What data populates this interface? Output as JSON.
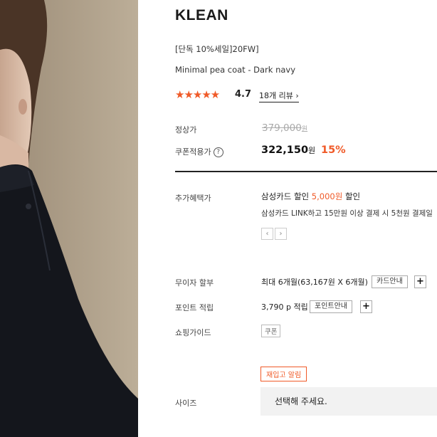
{
  "brand": "KLEAN",
  "promo": "[단독 10%세일]20FW]",
  "product_name": "Minimal pea coat - Dark navy",
  "rating": {
    "stars": "★★★★★",
    "score": "4.7",
    "reviews_link": "18개 리뷰 ›"
  },
  "price": {
    "regular_label": "정상가",
    "regular_value": "379,000",
    "regular_unit": "원",
    "coupon_label": "쿠폰적용가",
    "help_icon": "?",
    "sale_value": "322,150",
    "sale_unit": "원",
    "discount": "15%"
  },
  "benefits": {
    "label": "추가혜택가",
    "card_prefix": "삼성카드 할인 ",
    "card_amount": "5,000원",
    "card_suffix": " 할인",
    "description": "삼성카드 LINK하고 15만원 이상 결제 시 5천원 결제일",
    "prev": "‹",
    "next": "›"
  },
  "installment": {
    "label": "무이자 할부",
    "value": "최대 6개월(63,167원 X 6개월)",
    "button": "카드안내",
    "plus": "+"
  },
  "points": {
    "label": "포인트 적립",
    "value": "3,790 p 적립",
    "button": "포인트안내",
    "plus": "+"
  },
  "guide": {
    "label": "쇼핑가이드",
    "coupon": "쿠폰"
  },
  "restock_button": "재입고 알림",
  "size": {
    "label": "사이즈",
    "placeholder": "선택해 주세요."
  },
  "colors": {
    "accent": "#f05a28",
    "text": "#222222"
  }
}
